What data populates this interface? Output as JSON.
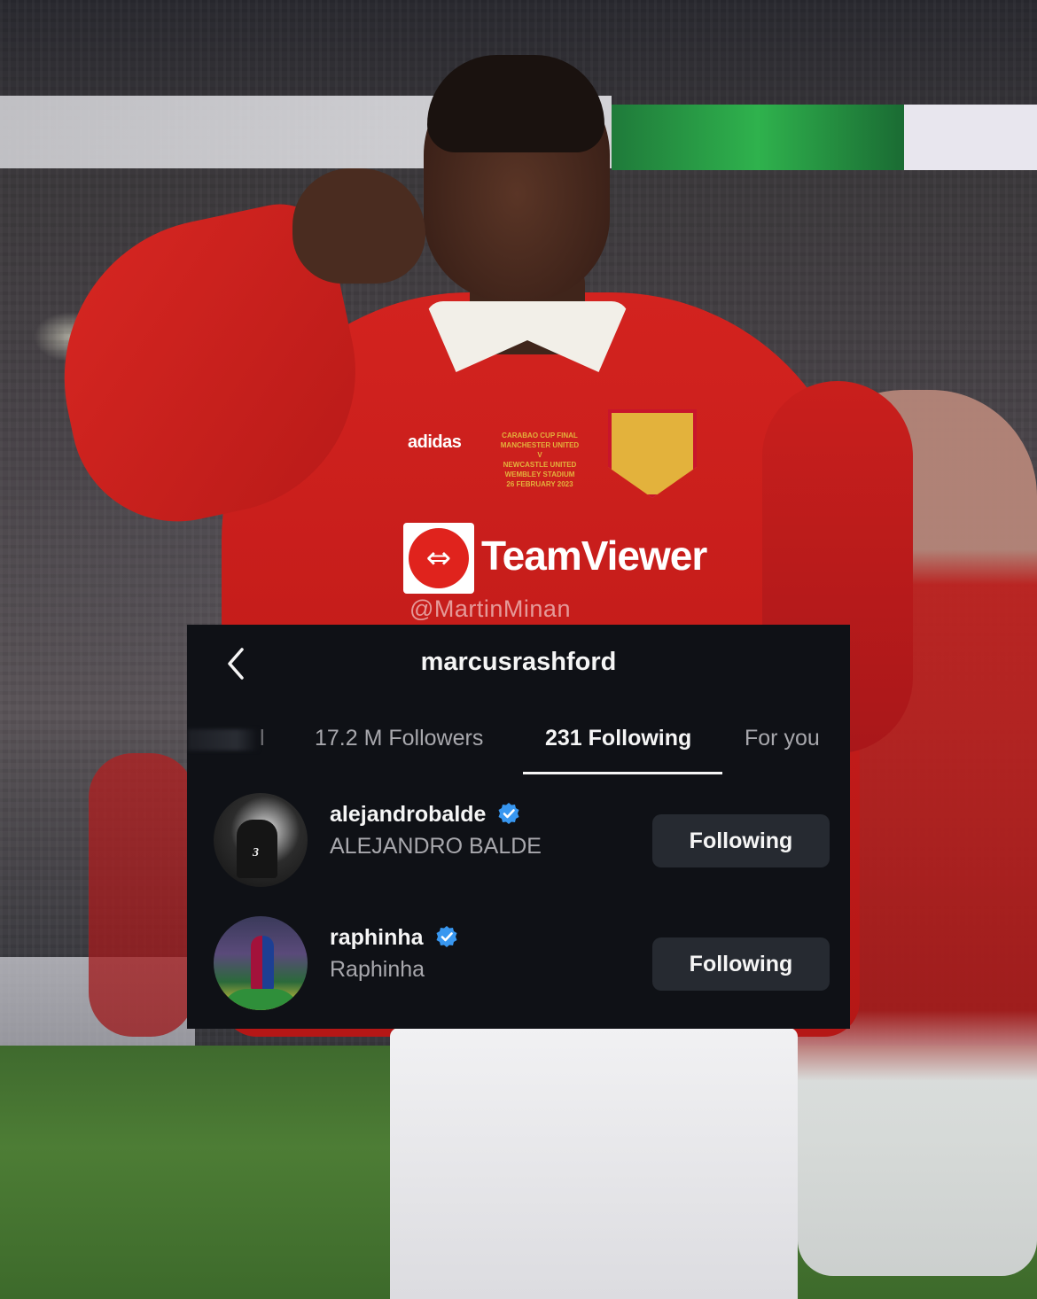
{
  "photo": {
    "watermark": "@MartinMinan",
    "sponsor_text": "TeamViewer",
    "kit_brand": "adidas",
    "match_detail": "CARABAO CUP FINAL\nMANCHESTER UNITED\nV\nNEWCASTLE UNITED\nWEMBLEY STADIUM\n26 FEBRUARY 2023"
  },
  "header": {
    "back_icon": "chevron-left-icon",
    "title": "marcusrashford"
  },
  "tabs": [
    {
      "label": "l",
      "active": false
    },
    {
      "label": "17.2 M Followers",
      "active": false
    },
    {
      "label": "231 Following",
      "active": true
    },
    {
      "label": "For you",
      "active": false
    }
  ],
  "accounts": [
    {
      "handle": "alejandrobalde",
      "name": "ALEJANDRO BALDE",
      "verified": true,
      "button": "Following",
      "jersey_number": "3"
    },
    {
      "handle": "raphinha",
      "name": "Raphinha",
      "verified": true,
      "button": "Following"
    }
  ],
  "colors": {
    "panel_bg": "#0f1116",
    "button_bg": "#262a31",
    "verified_blue": "#3897f0",
    "kit_red": "#c41c1a"
  }
}
